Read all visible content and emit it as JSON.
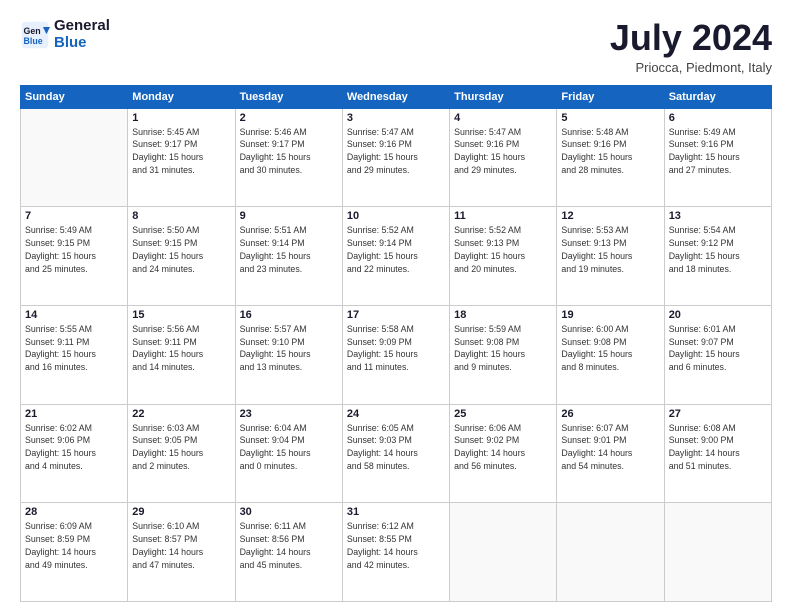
{
  "logo": {
    "line1": "General",
    "line2": "Blue"
  },
  "header": {
    "month_year": "July 2024",
    "location": "Priocca, Piedmont, Italy"
  },
  "days_of_week": [
    "Sunday",
    "Monday",
    "Tuesday",
    "Wednesday",
    "Thursday",
    "Friday",
    "Saturday"
  ],
  "weeks": [
    [
      {
        "num": "",
        "info": ""
      },
      {
        "num": "1",
        "info": "Sunrise: 5:45 AM\nSunset: 9:17 PM\nDaylight: 15 hours\nand 31 minutes."
      },
      {
        "num": "2",
        "info": "Sunrise: 5:46 AM\nSunset: 9:17 PM\nDaylight: 15 hours\nand 30 minutes."
      },
      {
        "num": "3",
        "info": "Sunrise: 5:47 AM\nSunset: 9:16 PM\nDaylight: 15 hours\nand 29 minutes."
      },
      {
        "num": "4",
        "info": "Sunrise: 5:47 AM\nSunset: 9:16 PM\nDaylight: 15 hours\nand 29 minutes."
      },
      {
        "num": "5",
        "info": "Sunrise: 5:48 AM\nSunset: 9:16 PM\nDaylight: 15 hours\nand 28 minutes."
      },
      {
        "num": "6",
        "info": "Sunrise: 5:49 AM\nSunset: 9:16 PM\nDaylight: 15 hours\nand 27 minutes."
      }
    ],
    [
      {
        "num": "7",
        "info": "Sunrise: 5:49 AM\nSunset: 9:15 PM\nDaylight: 15 hours\nand 25 minutes."
      },
      {
        "num": "8",
        "info": "Sunrise: 5:50 AM\nSunset: 9:15 PM\nDaylight: 15 hours\nand 24 minutes."
      },
      {
        "num": "9",
        "info": "Sunrise: 5:51 AM\nSunset: 9:14 PM\nDaylight: 15 hours\nand 23 minutes."
      },
      {
        "num": "10",
        "info": "Sunrise: 5:52 AM\nSunset: 9:14 PM\nDaylight: 15 hours\nand 22 minutes."
      },
      {
        "num": "11",
        "info": "Sunrise: 5:52 AM\nSunset: 9:13 PM\nDaylight: 15 hours\nand 20 minutes."
      },
      {
        "num": "12",
        "info": "Sunrise: 5:53 AM\nSunset: 9:13 PM\nDaylight: 15 hours\nand 19 minutes."
      },
      {
        "num": "13",
        "info": "Sunrise: 5:54 AM\nSunset: 9:12 PM\nDaylight: 15 hours\nand 18 minutes."
      }
    ],
    [
      {
        "num": "14",
        "info": "Sunrise: 5:55 AM\nSunset: 9:11 PM\nDaylight: 15 hours\nand 16 minutes."
      },
      {
        "num": "15",
        "info": "Sunrise: 5:56 AM\nSunset: 9:11 PM\nDaylight: 15 hours\nand 14 minutes."
      },
      {
        "num": "16",
        "info": "Sunrise: 5:57 AM\nSunset: 9:10 PM\nDaylight: 15 hours\nand 13 minutes."
      },
      {
        "num": "17",
        "info": "Sunrise: 5:58 AM\nSunset: 9:09 PM\nDaylight: 15 hours\nand 11 minutes."
      },
      {
        "num": "18",
        "info": "Sunrise: 5:59 AM\nSunset: 9:08 PM\nDaylight: 15 hours\nand 9 minutes."
      },
      {
        "num": "19",
        "info": "Sunrise: 6:00 AM\nSunset: 9:08 PM\nDaylight: 15 hours\nand 8 minutes."
      },
      {
        "num": "20",
        "info": "Sunrise: 6:01 AM\nSunset: 9:07 PM\nDaylight: 15 hours\nand 6 minutes."
      }
    ],
    [
      {
        "num": "21",
        "info": "Sunrise: 6:02 AM\nSunset: 9:06 PM\nDaylight: 15 hours\nand 4 minutes."
      },
      {
        "num": "22",
        "info": "Sunrise: 6:03 AM\nSunset: 9:05 PM\nDaylight: 15 hours\nand 2 minutes."
      },
      {
        "num": "23",
        "info": "Sunrise: 6:04 AM\nSunset: 9:04 PM\nDaylight: 15 hours\nand 0 minutes."
      },
      {
        "num": "24",
        "info": "Sunrise: 6:05 AM\nSunset: 9:03 PM\nDaylight: 14 hours\nand 58 minutes."
      },
      {
        "num": "25",
        "info": "Sunrise: 6:06 AM\nSunset: 9:02 PM\nDaylight: 14 hours\nand 56 minutes."
      },
      {
        "num": "26",
        "info": "Sunrise: 6:07 AM\nSunset: 9:01 PM\nDaylight: 14 hours\nand 54 minutes."
      },
      {
        "num": "27",
        "info": "Sunrise: 6:08 AM\nSunset: 9:00 PM\nDaylight: 14 hours\nand 51 minutes."
      }
    ],
    [
      {
        "num": "28",
        "info": "Sunrise: 6:09 AM\nSunset: 8:59 PM\nDaylight: 14 hours\nand 49 minutes."
      },
      {
        "num": "29",
        "info": "Sunrise: 6:10 AM\nSunset: 8:57 PM\nDaylight: 14 hours\nand 47 minutes."
      },
      {
        "num": "30",
        "info": "Sunrise: 6:11 AM\nSunset: 8:56 PM\nDaylight: 14 hours\nand 45 minutes."
      },
      {
        "num": "31",
        "info": "Sunrise: 6:12 AM\nSunset: 8:55 PM\nDaylight: 14 hours\nand 42 minutes."
      },
      {
        "num": "",
        "info": ""
      },
      {
        "num": "",
        "info": ""
      },
      {
        "num": "",
        "info": ""
      }
    ]
  ]
}
